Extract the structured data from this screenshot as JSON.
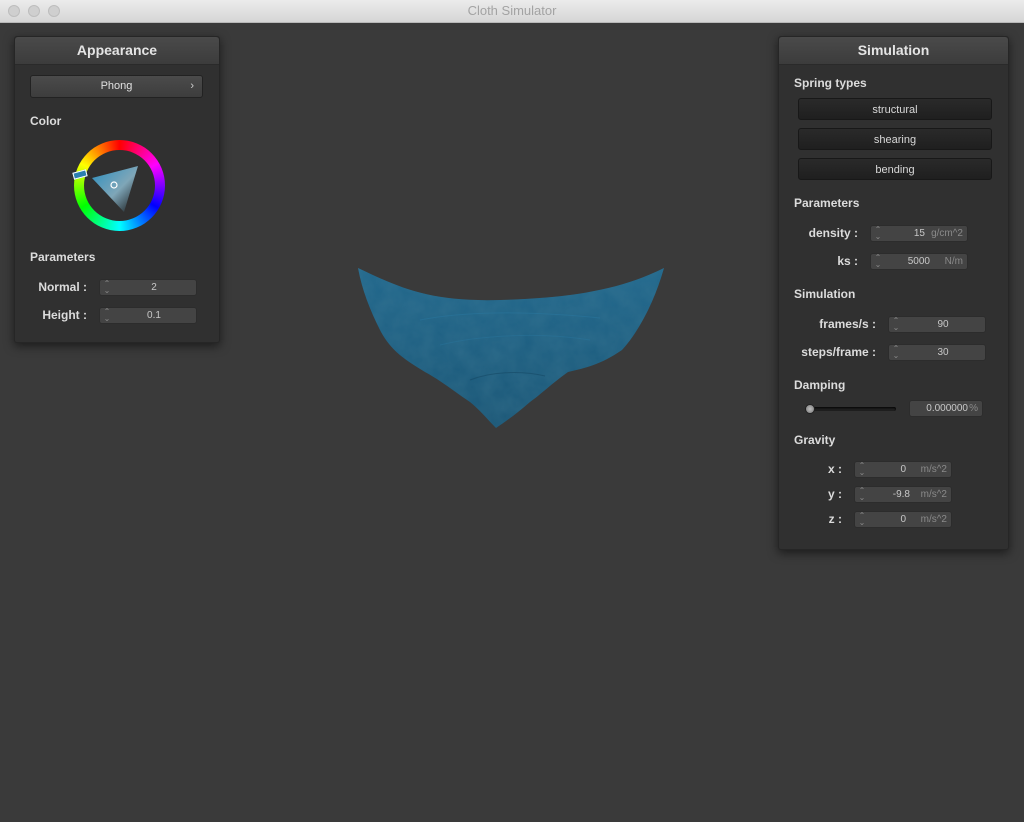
{
  "window": {
    "title": "Cloth Simulator"
  },
  "appearance": {
    "title": "Appearance",
    "shader": "Phong",
    "color_label": "Color",
    "color": "#1f5f82",
    "parameters_label": "Parameters",
    "normal_label": "Normal :",
    "normal_value": "2",
    "height_label": "Height :",
    "height_value": "0.1"
  },
  "simulation_panel": {
    "title": "Simulation",
    "spring_types_label": "Spring types",
    "spring_buttons": [
      "structural",
      "shearing",
      "bending"
    ],
    "parameters_label": "Parameters",
    "density_label": "density :",
    "density_value": "15",
    "density_unit": "g/cm^2",
    "ks_label": "ks :",
    "ks_value": "5000",
    "ks_unit": "N/m",
    "simulation_label": "Simulation",
    "fps_label": "frames/s :",
    "fps_value": "90",
    "steps_label": "steps/frame :",
    "steps_value": "30",
    "damping_label": "Damping",
    "damping_slider_fraction": 0.0,
    "damping_value": "0.000000",
    "damping_unit": "%",
    "gravity_label": "Gravity",
    "gx_label": "x :",
    "gx_value": "0",
    "gy_label": "y :",
    "gy_value": "-9.8",
    "gz_label": "z :",
    "gz_value": "0",
    "gravity_unit": "m/s^2"
  },
  "icons": {
    "dropdown": "chevron-right-icon",
    "spinner": "spinner-arrows-icon",
    "window_buttons": [
      "close-button",
      "minimize-button",
      "zoom-button"
    ]
  }
}
